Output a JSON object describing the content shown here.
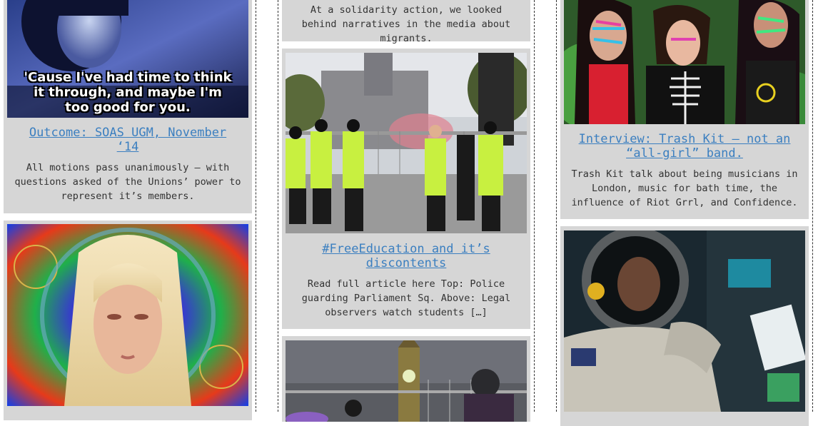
{
  "posts": [
    {
      "image_alt": "Still from music video with subtitle",
      "image_caption": "'Cause I've had time to think it through, and maybe I'm too good for you.",
      "title": "Outcome: SOAS UGM, November ‘14",
      "excerpt": "All motions pass unanimously – with questions asked of the Unions’ power to represent it’s members."
    },
    {
      "image_alt": "Portrait with psychedelic background"
    },
    {
      "excerpt": "At a solidarity action, we looked behind narratives in the media about migrants."
    },
    {
      "image_alt": "Police at Parliament Square",
      "title": "#FreeEducation and it’s discontents",
      "excerpt": "Read full article here   Top: Police guarding Parliament Sq. Above: Legal observers watch students […]"
    },
    {
      "image_alt": "Big Ben at night with crowd"
    },
    {
      "image_alt": "Band members with face paint",
      "title": "Interview: Trash Kit – not an “all-girl” band.",
      "excerpt": "Trash Kit talk about being musicians in London, music for bath time, the influence of Riot Grrl, and Confidence."
    },
    {
      "image_alt": "Astronaut in spacecraft cockpit"
    }
  ]
}
